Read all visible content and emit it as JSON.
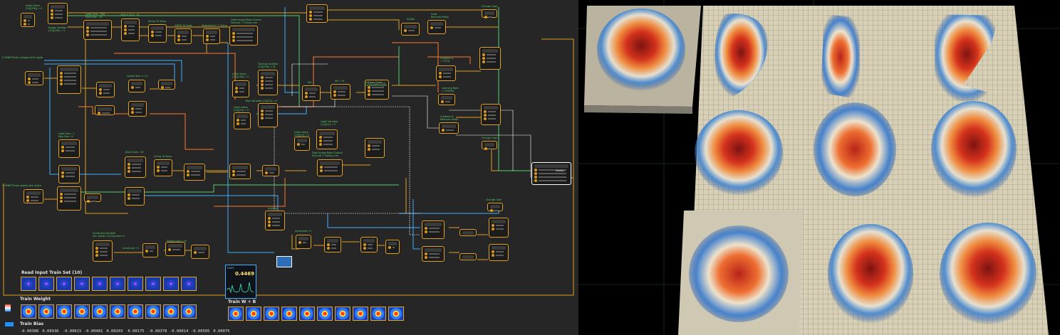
{
  "app": {
    "accent": "#e0a020",
    "wire_colors": [
      "#e0a020",
      "#3fb0ff",
      "#ff7a2a",
      "#55d06a",
      "#ffffff"
    ]
  },
  "graph": {
    "labels": {
      "initial_value_top": "Initial Value\n[10][784] = 0",
      "image_variable": "Image Variable\n[10][784] = 0",
      "label_size": "Label Size : 784\nStep Size : 10",
      "batch_size_top": "Batch Size : 10",
      "string_to_value_top": "String To Value",
      "uint8_to_float": "UINT8 To Float",
      "normalize": "Normalize 0~1 Value",
      "data_image_read_top": "Data Image Read Control\nInterval = Turing num",
      "cs_path_images": "C:\\MNIST\\train-images.idx3-ubyte",
      "queue_size": "Queue Size >= 0",
      "initial_value_w": "Initial Value\n[10][784] = 0",
      "training_variable": "Training Variable\n[10][784] = W",
      "bias_variable": "Bias Variable [10][10] = 0",
      "initial_value_b": "Initial Value\n[10][10] = 0",
      "wx": "WX",
      "wx_b": "WX + B",
      "softmax": "Softmax Cross\nEntropyWithLogits",
      "gradient_a": "Gradient A\n= 0.5*A",
      "learning_rate": "Learning Rate\n= 0.00001",
      "gradient_b": "Gradient B\nReduced Mean",
      "dy_dw": "Dy/Dw",
      "grad_reduced": "Grad\nReduced Mean",
      "change_oper_top": "Change Oper",
      "change_oper_mid": "Change Oper",
      "change_oper_low": "Change Oper",
      "label_size_2": "Label Size : 1\nMax Size : 8",
      "batch_size_2": "Batch Size : 10",
      "string_to_value_2": "String To Value",
      "label_variable": "Label Variable\n[10][10] = 0",
      "initial_value_l": "Initial Value\n[10][10] = 0",
      "data_image_read_2": "Data Image Read Control\nInterval = Turing num",
      "cs_path_labels": "C:\\MNIST\\train-labels.idx1-ubyte",
      "increment_variable": "Increment Variable\nInit. Value= Turing Num+1",
      "increment": "Increment +1",
      "turing_num": "Turing num > 10",
      "argmax": "Argmax",
      "increment2": "Increment +1",
      "display": "display"
    },
    "cost": {
      "title": "COST",
      "value": "0.4469"
    },
    "read_input": {
      "title": "Read Input Train Set (10)"
    },
    "train_weight": {
      "title": "Train Weight"
    },
    "train_wb": {
      "title": "Train W + B"
    },
    "train_bias": {
      "title": "Train Bias",
      "values": [
        "-0.00386",
        "0.00936",
        "-0.00615",
        "-0.00481",
        "0.00203",
        "0.00175",
        "-0.00378",
        "-0.00014",
        "-0.00505",
        "0.00075"
      ]
    }
  },
  "view3d": {
    "background": "#000000"
  }
}
